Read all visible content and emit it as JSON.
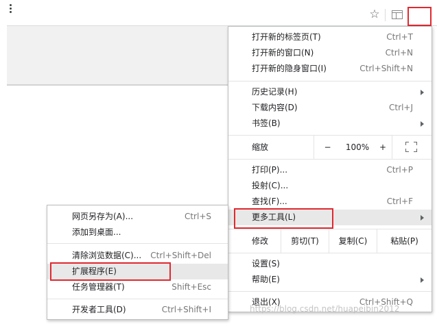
{
  "colors": {
    "highlight_box": "#e0282f",
    "menu_highlight": "#e8e8e8"
  },
  "toolbar": {
    "icons": [
      "star-icon",
      "extension-icon",
      "kebab-menu-icon"
    ],
    "star_glyph": "☆"
  },
  "main_menu": {
    "new_tab": {
      "label": "打开新的标签页(T)",
      "shortcut": "Ctrl+T"
    },
    "new_window": {
      "label": "打开新的窗口(N)",
      "shortcut": "Ctrl+N"
    },
    "new_incognito": {
      "label": "打开新的隐身窗口(I)",
      "shortcut": "Ctrl+Shift+N"
    },
    "history": {
      "label": "历史记录(H)"
    },
    "downloads": {
      "label": "下载内容(D)",
      "shortcut": "Ctrl+J"
    },
    "bookmarks": {
      "label": "书签(B)"
    },
    "zoom": {
      "label": "缩放",
      "minus": "−",
      "value": "100%",
      "plus": "+"
    },
    "print": {
      "label": "打印(P)...",
      "shortcut": "Ctrl+P"
    },
    "cast": {
      "label": "投射(C)..."
    },
    "find": {
      "label": "查找(F)...",
      "shortcut": "Ctrl+F"
    },
    "more_tools": {
      "label": "更多工具(L)"
    },
    "edit": {
      "label": "修改",
      "cut": "剪切(T)",
      "copy": "复制(C)",
      "paste": "粘贴(P)"
    },
    "settings": {
      "label": "设置(S)"
    },
    "help": {
      "label": "帮助(E)"
    },
    "exit": {
      "label": "退出(X)",
      "shortcut": "Ctrl+Shift+Q"
    }
  },
  "sub_menu": {
    "save_page": {
      "label": "网页另存为(A)...",
      "shortcut": "Ctrl+S"
    },
    "add_desktop": {
      "label": "添加到桌面..."
    },
    "clear_data": {
      "label": "清除浏览数据(C)...",
      "shortcut": "Ctrl+Shift+Del"
    },
    "extensions": {
      "label": "扩展程序(E)"
    },
    "task_manager": {
      "label": "任务管理器(T)",
      "shortcut": "Shift+Esc"
    },
    "dev_tools": {
      "label": "开发者工具(D)",
      "shortcut": "Ctrl+Shift+I"
    }
  },
  "watermark": "https://blog.csdn.net/huapeibin2012"
}
